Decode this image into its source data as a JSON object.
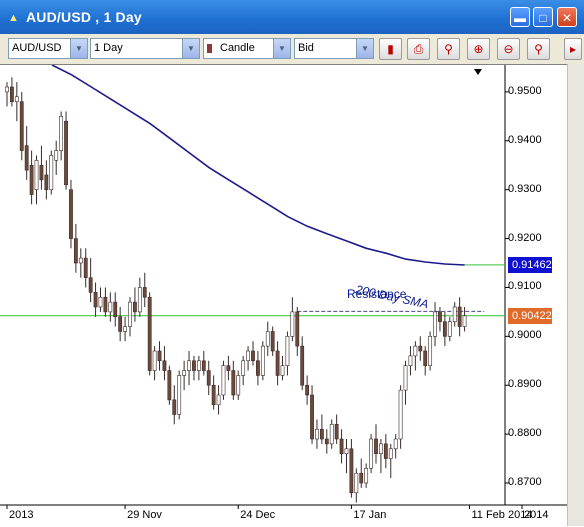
{
  "window": {
    "title": "AUD/USD , 1 Day",
    "controls": [
      "minimize-icon",
      "maximize-icon",
      "close-icon"
    ]
  },
  "toolbar": {
    "symbol": "AUD/USD",
    "timeframe": "1 Day",
    "chart_type": "Candle",
    "price_type": "Bid",
    "buttons": [
      "chart-settings-icon",
      "print-icon",
      "zoom-icon",
      "zoom-in-icon",
      "zoom-out-icon",
      "zoom-fit-icon"
    ]
  },
  "colors": {
    "candle_body": "#6b4a3a",
    "sma_line": "#1a1a8c",
    "sma_label": "#0a1a8a",
    "green_line": "#34c434",
    "price_box_blue": "#1010d0",
    "price_box_orange": "#e06a2a"
  },
  "chart_data": {
    "type": "candlestick",
    "symbol": "AUD/USD",
    "timeframe": "1 Day",
    "ylim": [
      0.8655,
      0.9555
    ],
    "y_ticks": [
      "0.9500",
      "0.9400",
      "0.9300",
      "0.9200",
      "0.9100",
      "0.9000",
      "0.8900",
      "0.8800",
      "0.8700"
    ],
    "y_tick_values": [
      0.95,
      0.94,
      0.93,
      0.92,
      0.91,
      0.9,
      0.89,
      0.88,
      0.87
    ],
    "x_ticks": [
      "2013",
      "29 Nov",
      "24 Dec",
      "17 Jan",
      "11 Feb 2014",
      "2014"
    ],
    "x_tick_index": [
      0,
      24,
      47,
      70,
      94,
      110
    ],
    "current_price_label": "0.90422",
    "current_price": 0.90422,
    "sma_price_label": "0.91462",
    "sma_value": 0.91462,
    "annotations": {
      "sma": "200 Day SMA",
      "resistance": "Resistance"
    },
    "resistance_level": 0.9051,
    "sma_series": [
      0.9555,
      0.9535,
      0.951,
      0.9485,
      0.946,
      0.9435,
      0.9405,
      0.9375,
      0.9345,
      0.932,
      0.9295,
      0.927,
      0.9245,
      0.9225,
      0.921,
      0.9195,
      0.918,
      0.917,
      0.9158,
      0.9152,
      0.9148,
      0.9146
    ],
    "candles": [
      [
        0.95,
        0.952,
        0.947,
        0.951
      ],
      [
        0.951,
        0.953,
        0.947,
        0.948
      ],
      [
        0.948,
        0.952,
        0.944,
        0.949
      ],
      [
        0.948,
        0.95,
        0.936,
        0.938
      ],
      [
        0.939,
        0.943,
        0.932,
        0.934
      ],
      [
        0.935,
        0.938,
        0.927,
        0.929
      ],
      [
        0.93,
        0.937,
        0.927,
        0.936
      ],
      [
        0.935,
        0.939,
        0.93,
        0.932
      ],
      [
        0.933,
        0.936,
        0.928,
        0.93
      ],
      [
        0.93,
        0.938,
        0.929,
        0.937
      ],
      [
        0.936,
        0.94,
        0.933,
        0.938
      ],
      [
        0.938,
        0.946,
        0.936,
        0.945
      ],
      [
        0.944,
        0.946,
        0.93,
        0.931
      ],
      [
        0.93,
        0.932,
        0.918,
        0.92
      ],
      [
        0.92,
        0.923,
        0.913,
        0.915
      ],
      [
        0.915,
        0.918,
        0.912,
        0.916
      ],
      [
        0.916,
        0.918,
        0.91,
        0.912
      ],
      [
        0.912,
        0.916,
        0.907,
        0.909
      ],
      [
        0.909,
        0.911,
        0.904,
        0.906
      ],
      [
        0.906,
        0.91,
        0.905,
        0.908
      ],
      [
        0.908,
        0.91,
        0.904,
        0.905
      ],
      [
        0.905,
        0.909,
        0.903,
        0.907
      ],
      [
        0.907,
        0.909,
        0.902,
        0.904
      ],
      [
        0.904,
        0.906,
        0.899,
        0.901
      ],
      [
        0.901,
        0.904,
        0.899,
        0.902
      ],
      [
        0.902,
        0.908,
        0.9,
        0.907
      ],
      [
        0.907,
        0.91,
        0.903,
        0.905
      ],
      [
        0.905,
        0.912,
        0.904,
        0.91
      ],
      [
        0.91,
        0.913,
        0.906,
        0.908
      ],
      [
        0.908,
        0.909,
        0.892,
        0.893
      ],
      [
        0.893,
        0.898,
        0.891,
        0.897
      ],
      [
        0.897,
        0.899,
        0.893,
        0.895
      ],
      [
        0.895,
        0.898,
        0.891,
        0.893
      ],
      [
        0.893,
        0.894,
        0.886,
        0.887
      ],
      [
        0.887,
        0.89,
        0.882,
        0.884
      ],
      [
        0.884,
        0.893,
        0.883,
        0.892
      ],
      [
        0.892,
        0.895,
        0.889,
        0.893
      ],
      [
        0.893,
        0.897,
        0.89,
        0.895
      ],
      [
        0.895,
        0.896,
        0.891,
        0.893
      ],
      [
        0.893,
        0.896,
        0.891,
        0.895
      ],
      [
        0.895,
        0.897,
        0.892,
        0.893
      ],
      [
        0.893,
        0.895,
        0.888,
        0.89
      ],
      [
        0.89,
        0.892,
        0.885,
        0.886
      ],
      [
        0.886,
        0.89,
        0.884,
        0.888
      ],
      [
        0.888,
        0.895,
        0.887,
        0.894
      ],
      [
        0.894,
        0.896,
        0.891,
        0.893
      ],
      [
        0.893,
        0.895,
        0.887,
        0.888
      ],
      [
        0.888,
        0.893,
        0.887,
        0.892
      ],
      [
        0.892,
        0.896,
        0.89,
        0.895
      ],
      [
        0.895,
        0.898,
        0.893,
        0.897
      ],
      [
        0.897,
        0.899,
        0.894,
        0.895
      ],
      [
        0.895,
        0.897,
        0.89,
        0.892
      ],
      [
        0.892,
        0.899,
        0.891,
        0.898
      ],
      [
        0.898,
        0.903,
        0.896,
        0.901
      ],
      [
        0.901,
        0.902,
        0.896,
        0.897
      ],
      [
        0.897,
        0.899,
        0.89,
        0.892
      ],
      [
        0.892,
        0.896,
        0.891,
        0.894
      ],
      [
        0.894,
        0.901,
        0.892,
        0.9
      ],
      [
        0.9,
        0.908,
        0.899,
        0.905
      ],
      [
        0.905,
        0.906,
        0.896,
        0.898
      ],
      [
        0.898,
        0.9,
        0.889,
        0.89
      ],
      [
        0.89,
        0.892,
        0.886,
        0.888
      ],
      [
        0.888,
        0.89,
        0.878,
        0.879
      ],
      [
        0.879,
        0.883,
        0.877,
        0.881
      ],
      [
        0.881,
        0.884,
        0.878,
        0.879
      ],
      [
        0.879,
        0.881,
        0.876,
        0.878
      ],
      [
        0.878,
        0.883,
        0.877,
        0.882
      ],
      [
        0.882,
        0.884,
        0.878,
        0.879
      ],
      [
        0.879,
        0.881,
        0.874,
        0.876
      ],
      [
        0.876,
        0.879,
        0.872,
        0.877
      ],
      [
        0.877,
        0.879,
        0.867,
        0.868
      ],
      [
        0.868,
        0.873,
        0.866,
        0.872
      ],
      [
        0.872,
        0.875,
        0.869,
        0.87
      ],
      [
        0.87,
        0.874,
        0.869,
        0.873
      ],
      [
        0.873,
        0.88,
        0.872,
        0.879
      ],
      [
        0.879,
        0.882,
        0.874,
        0.876
      ],
      [
        0.876,
        0.879,
        0.872,
        0.878
      ],
      [
        0.878,
        0.88,
        0.873,
        0.875
      ],
      [
        0.875,
        0.878,
        0.871,
        0.877
      ],
      [
        0.877,
        0.88,
        0.875,
        0.879
      ],
      [
        0.879,
        0.89,
        0.877,
        0.889
      ],
      [
        0.889,
        0.895,
        0.886,
        0.894
      ],
      [
        0.894,
        0.898,
        0.892,
        0.896
      ],
      [
        0.896,
        0.899,
        0.893,
        0.898
      ],
      [
        0.898,
        0.9,
        0.895,
        0.897
      ],
      [
        0.897,
        0.898,
        0.892,
        0.894
      ],
      [
        0.894,
        0.901,
        0.893,
        0.9
      ],
      [
        0.9,
        0.907,
        0.898,
        0.905
      ],
      [
        0.905,
        0.906,
        0.901,
        0.903
      ],
      [
        0.903,
        0.905,
        0.898,
        0.9
      ],
      [
        0.9,
        0.904,
        0.899,
        0.903
      ],
      [
        0.903,
        0.907,
        0.902,
        0.906
      ],
      [
        0.906,
        0.908,
        0.9,
        0.902
      ],
      [
        0.902,
        0.906,
        0.901,
        0.9042
      ]
    ]
  }
}
